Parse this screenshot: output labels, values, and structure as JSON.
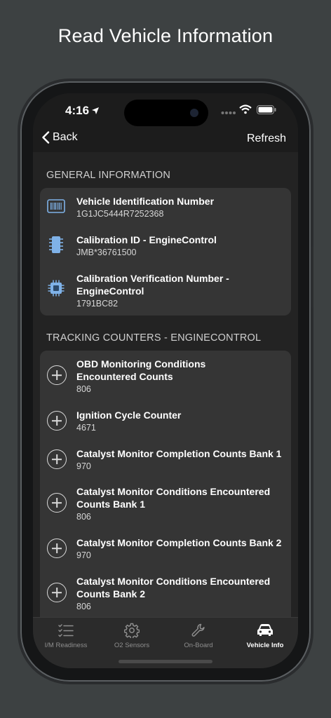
{
  "promo": {
    "title": "Read Vehicle Information"
  },
  "status_bar": {
    "time": "4:16"
  },
  "nav": {
    "back_label": "Back",
    "refresh_label": "Refresh"
  },
  "general": {
    "header": "GENERAL INFORMATION",
    "items": [
      {
        "icon": "barcode-icon",
        "title": "Vehicle Identification Number",
        "value": "1G1JC5444R7252368"
      },
      {
        "icon": "chip-icon",
        "title": "Calibration ID - EngineControl",
        "value": "JMB*36761500"
      },
      {
        "icon": "processor-icon",
        "title_line1": "Calibration Verification Number -",
        "title_line2": "EngineControl",
        "value": "1791BC82"
      }
    ]
  },
  "tracking": {
    "header": "TRACKING COUNTERS - ENGINECONTROL",
    "items": [
      {
        "title_line1": "OBD Monitoring Conditions",
        "title_line2": "Encountered Counts",
        "value": "806"
      },
      {
        "title_line1": "Ignition Cycle Counter",
        "value": "4671"
      },
      {
        "title_line1": "Catalyst Monitor Completion Counts Bank 1",
        "value": "970"
      },
      {
        "title_line1": "Catalyst Monitor Conditions Encountered",
        "title_line2": "Counts Bank 1",
        "value": "806"
      },
      {
        "title_line1": "Catalyst Monitor Completion Counts Bank 2",
        "value": "970"
      },
      {
        "title_line1": "Catalyst Monitor Conditions Encountered",
        "title_line2": "Counts Bank 2",
        "value": "806"
      }
    ]
  },
  "tabs": [
    {
      "label": "I/M Readiness",
      "icon": "checklist-icon",
      "active": false
    },
    {
      "label": "O2 Sensors",
      "icon": "gear-icon",
      "active": false
    },
    {
      "label": "On-Board",
      "icon": "wrench-icon",
      "active": false
    },
    {
      "label": "Vehicle Info",
      "icon": "car-icon",
      "active": true
    }
  ],
  "colors": {
    "background": "#3d4142",
    "card": "#353535",
    "accent_icon": "#7fb2e8"
  }
}
